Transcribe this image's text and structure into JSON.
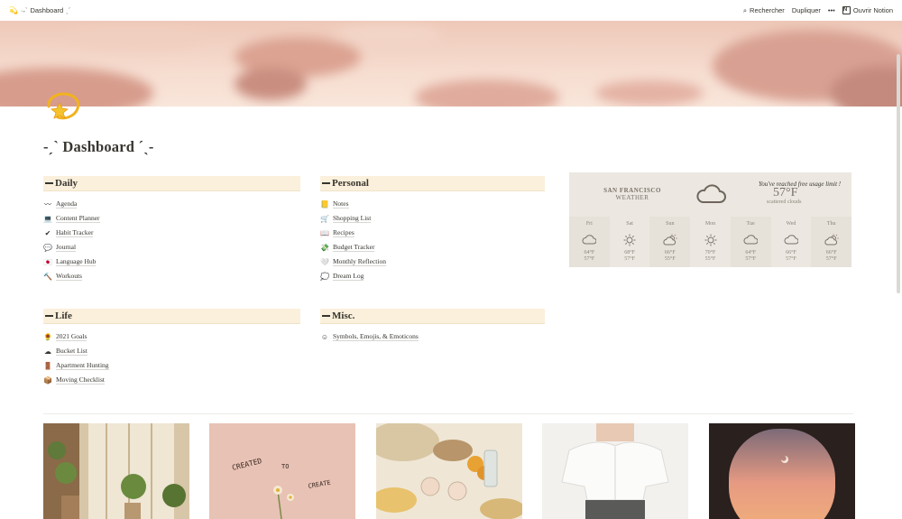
{
  "topbar": {
    "breadcrumb": "꒰ ˎˊ˗ Dashboard ˎˊ˗",
    "breadcrumb_text": "Dashboard",
    "breadcrumb_prefix": "·˖`",
    "breadcrumb_suffix": "ˎˊ",
    "search_label": "Rechercher",
    "duplicate_label": "Dupliquer",
    "more_label": "•••",
    "open_notion_label": "Ouvrir Notion"
  },
  "page": {
    "title": "-ˏˋ Dashboard ˊˎ-"
  },
  "sections": {
    "daily": {
      "heading": "Daily",
      "items": [
        {
          "icon": "〰",
          "label": "Agenda"
        },
        {
          "icon": "💻",
          "label": "Content Planner"
        },
        {
          "icon": "✔",
          "label": "Habit Tracker"
        },
        {
          "icon": "💬",
          "label": "Journal"
        },
        {
          "icon": "🇯🇵",
          "label": "Language Hub"
        },
        {
          "icon": "🔨",
          "label": "Workouts"
        }
      ]
    },
    "personal": {
      "heading": "Personal",
      "items": [
        {
          "icon": "📒",
          "label": "Notes"
        },
        {
          "icon": "🛒",
          "label": "Shopping List"
        },
        {
          "icon": "📖",
          "label": "Recipes"
        },
        {
          "icon": "💸",
          "label": "Budget Tracker"
        },
        {
          "icon": "🤍",
          "label": "Monthly Reflection"
        },
        {
          "icon": "💭",
          "label": "Dream Log"
        }
      ]
    },
    "life": {
      "heading": "Life",
      "items": [
        {
          "icon": "🌻",
          "label": "2021 Goals"
        },
        {
          "icon": "☁",
          "label": "Bucket List"
        },
        {
          "icon": "🚪",
          "label": "Apartment Hunting"
        },
        {
          "icon": "📦",
          "label": "Moving Checklist"
        }
      ]
    },
    "misc": {
      "heading": "Misc.",
      "items": [
        {
          "icon": "☺",
          "label": "Symbols, Emojis, & Emoticons"
        }
      ]
    }
  },
  "weather": {
    "city": "SAN FRANCISCO",
    "subtitle": "WEATHER",
    "limit_notice": "You've reached free usage limit !",
    "temperature": "57°F",
    "condition": "scattered clouds",
    "days": [
      {
        "name": "Fri",
        "icon": "cloud",
        "high": "64°F",
        "low": "57°F"
      },
      {
        "name": "Sat",
        "icon": "sun",
        "high": "68°F",
        "low": "57°F"
      },
      {
        "name": "Sun",
        "icon": "partly-cloudy",
        "high": "66°F",
        "low": "55°F"
      },
      {
        "name": "Mon",
        "icon": "sun",
        "high": "70°F",
        "low": "55°F"
      },
      {
        "name": "Tue",
        "icon": "cloud",
        "high": "64°F",
        "low": "57°F"
      },
      {
        "name": "Wed",
        "icon": "cloud",
        "high": "66°F",
        "low": "57°F"
      },
      {
        "name": "Thu",
        "icon": "partly-cloudy",
        "high": "66°F",
        "low": "57°F"
      }
    ]
  },
  "gallery": [
    {
      "name": "plants-room"
    },
    {
      "name": "created-to-create",
      "text1": "CREATED",
      "text2": "TO",
      "text3": "CREATE"
    },
    {
      "name": "picnic"
    },
    {
      "name": "white-blouse"
    },
    {
      "name": "airplane-window"
    }
  ],
  "colors": {
    "section_header_bg": "#fbf0dc",
    "text": "#37352f",
    "weather_bg": "#ece8e1"
  }
}
